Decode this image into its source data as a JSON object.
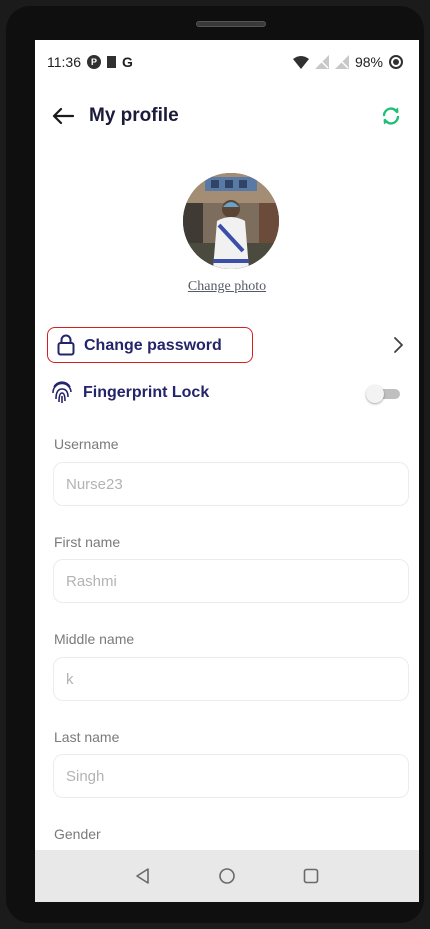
{
  "status_bar": {
    "time": "11:36",
    "app_icons": [
      "p-icon",
      "square-icon",
      "google-g-icon"
    ],
    "carrier_letter": "G",
    "battery": "98%"
  },
  "header": {
    "title": "My profile",
    "back_icon": "arrow-left-icon",
    "sync_icon": "sync-icon"
  },
  "profile": {
    "change_photo": "Change photo"
  },
  "settings": {
    "change_password": "Change password",
    "fingerprint_lock": "Fingerprint Lock",
    "fingerprint_enabled": false
  },
  "form": {
    "username": {
      "label": "Username",
      "value": "Nurse23"
    },
    "first_name": {
      "label": "First name",
      "value": "Rashmi"
    },
    "middle_name": {
      "label": "Middle name",
      "value": "k"
    },
    "last_name": {
      "label": "Last name",
      "value": "Singh"
    },
    "gender": {
      "label": "Gender"
    }
  },
  "colors": {
    "accent": "#24246a",
    "sync": "#1fbf7a",
    "highlight": "#d62020"
  }
}
